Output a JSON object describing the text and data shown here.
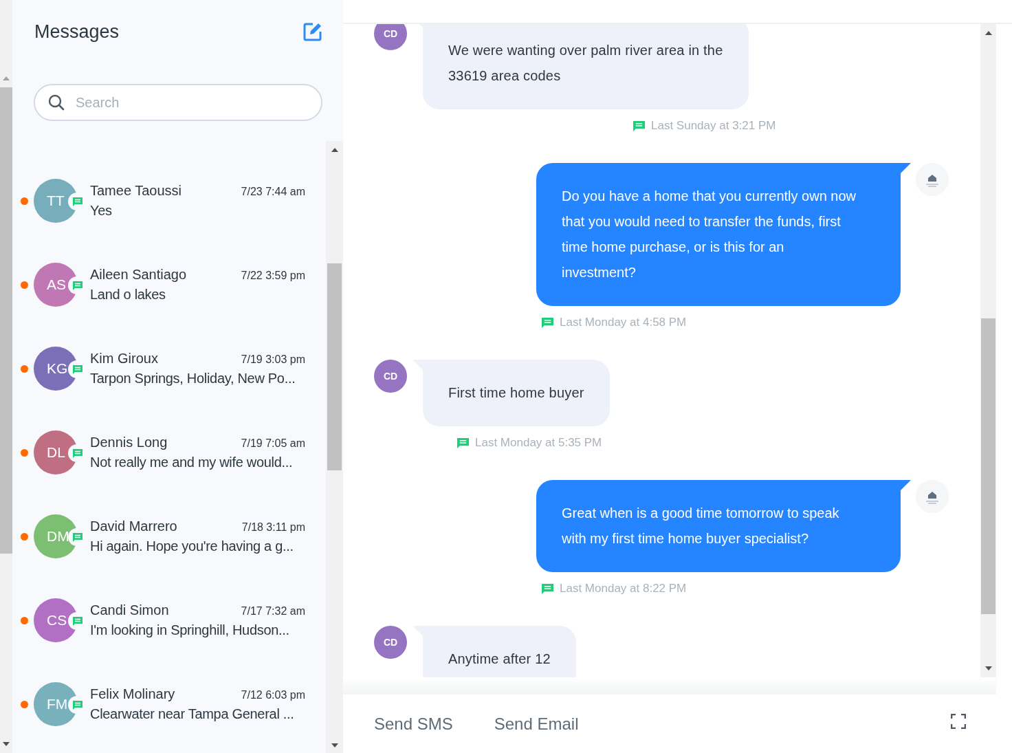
{
  "sidebar": {
    "title": "Messages",
    "search": {
      "placeholder": "Search"
    },
    "conversations": [
      {
        "initials": "TT",
        "color": "#78adbb",
        "name": "Tamee Taoussi",
        "time": "7/23 7:44 am",
        "preview": "Yes",
        "unread": true
      },
      {
        "initials": "AS",
        "color": "#c078b5",
        "name": "Aileen Santiago",
        "time": "7/22 3:59 pm",
        "preview": "Land o lakes",
        "unread": true
      },
      {
        "initials": "KG",
        "color": "#7b70b8",
        "name": "Kim Giroux",
        "time": "7/19 3:03 pm",
        "preview": "Tarpon Springs, Holiday, New Po...",
        "unread": true
      },
      {
        "initials": "DL",
        "color": "#c06f83",
        "name": "Dennis Long",
        "time": "7/19 7:05 am",
        "preview": "Not really me and my wife would...",
        "unread": true
      },
      {
        "initials": "DM",
        "color": "#7dbf72",
        "name": "David Marrero",
        "time": "7/18 3:11 pm",
        "preview": "Hi again. Hope you're having a g...",
        "unread": true
      },
      {
        "initials": "CS",
        "color": "#b170c4",
        "name": "Candi Simon",
        "time": "7/17 7:32 am",
        "preview": "I'm looking in Springhill, Hudson...",
        "unread": true
      },
      {
        "initials": "FM",
        "color": "#78b0bb",
        "name": "Felix Molinary",
        "time": "7/12 6:03 pm",
        "preview": "Clearwater near Tampa General ...",
        "unread": true
      }
    ]
  },
  "chat": {
    "messages": [
      {
        "kind": "incoming",
        "initials": "CD",
        "lines": [
          "We were wanting over palm river area in the",
          "33619 area codes"
        ],
        "time": "Last Sunday at 3:21 PM"
      },
      {
        "kind": "outgoing",
        "lines": [
          "Do you have a home that you currently own now",
          "that you would need to transfer the funds, first",
          "time home purchase, or is this for an",
          "investment?"
        ],
        "time": "Last Monday at 4:58 PM"
      },
      {
        "kind": "incoming",
        "initials": "CD",
        "lines": [
          "First time home buyer"
        ],
        "time": "Last Monday at 5:35 PM"
      },
      {
        "kind": "outgoing",
        "lines": [
          "Great when is a good time tomorrow to speak",
          "with my first time home buyer specialist?"
        ],
        "time": "Last Monday at 8:22 PM"
      },
      {
        "kind": "incoming",
        "initials": "CD",
        "lines": [
          "Anytime after 12"
        ]
      }
    ],
    "composer": {
      "actions": [
        "Send SMS",
        "Send Email"
      ]
    }
  }
}
